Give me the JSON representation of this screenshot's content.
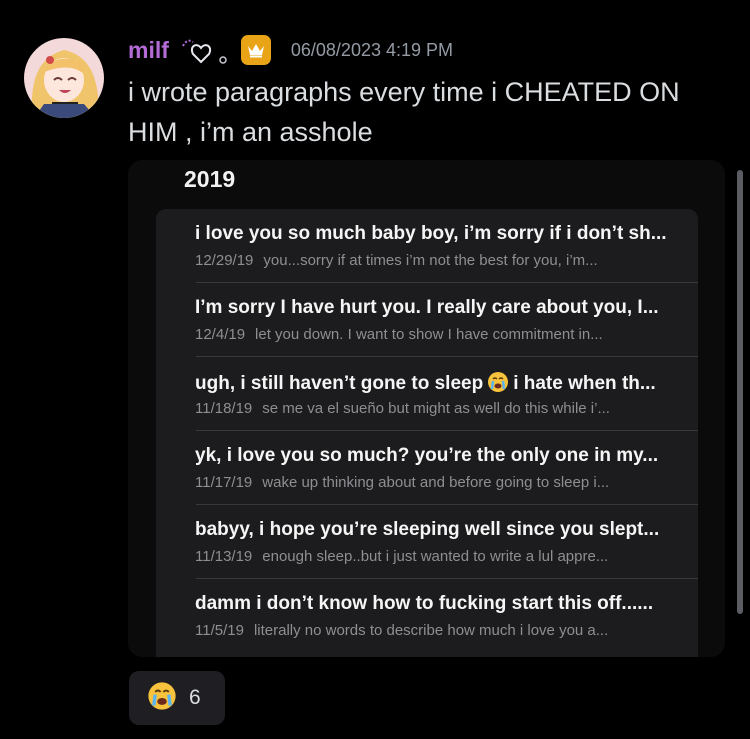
{
  "message": {
    "username": "milf",
    "timestamp": "06/08/2023 4:19 PM",
    "text": "i wrote paragraphs every time i CHEATED ON HIM , i’m an asshole"
  },
  "attachment": {
    "year": "2019",
    "notes": [
      {
        "title": "i love you so much baby boy, i’m sorry if i don’t sh...",
        "date": "12/29/19",
        "preview": "you...sorry if at times i’m not the best for you, i’m..."
      },
      {
        "title": "I’m sorry I have hurt you. I really care about you, I...",
        "date": "12/4/19",
        "preview": "let you down. I want to show I have commitment in..."
      },
      {
        "title_a": "ugh, i still haven’t gone to sleep",
        "title_b": "i hate when th...",
        "date": "11/18/19",
        "preview": "se me va el sueño but might as well do this while i’..."
      },
      {
        "title": "yk, i love you so much? you’re the only one in my...",
        "date": "11/17/19",
        "preview": "wake up thinking about and before going to sleep i..."
      },
      {
        "title": "babyy, i hope you’re sleeping well since you slept...",
        "date": "11/13/19",
        "preview": "enough sleep..but i just wanted to write a lul appre..."
      },
      {
        "title": "damm i don’t know how to fucking start this off......",
        "date": "11/5/19",
        "preview": "literally no words to describe how much i love you a..."
      }
    ]
  },
  "reaction": {
    "emoji": "crying-face",
    "count": "6"
  },
  "colors": {
    "username": "#b36bd6",
    "crown": "#e8a317",
    "background": "#000000",
    "notes_bg": "#1c1c1e"
  }
}
